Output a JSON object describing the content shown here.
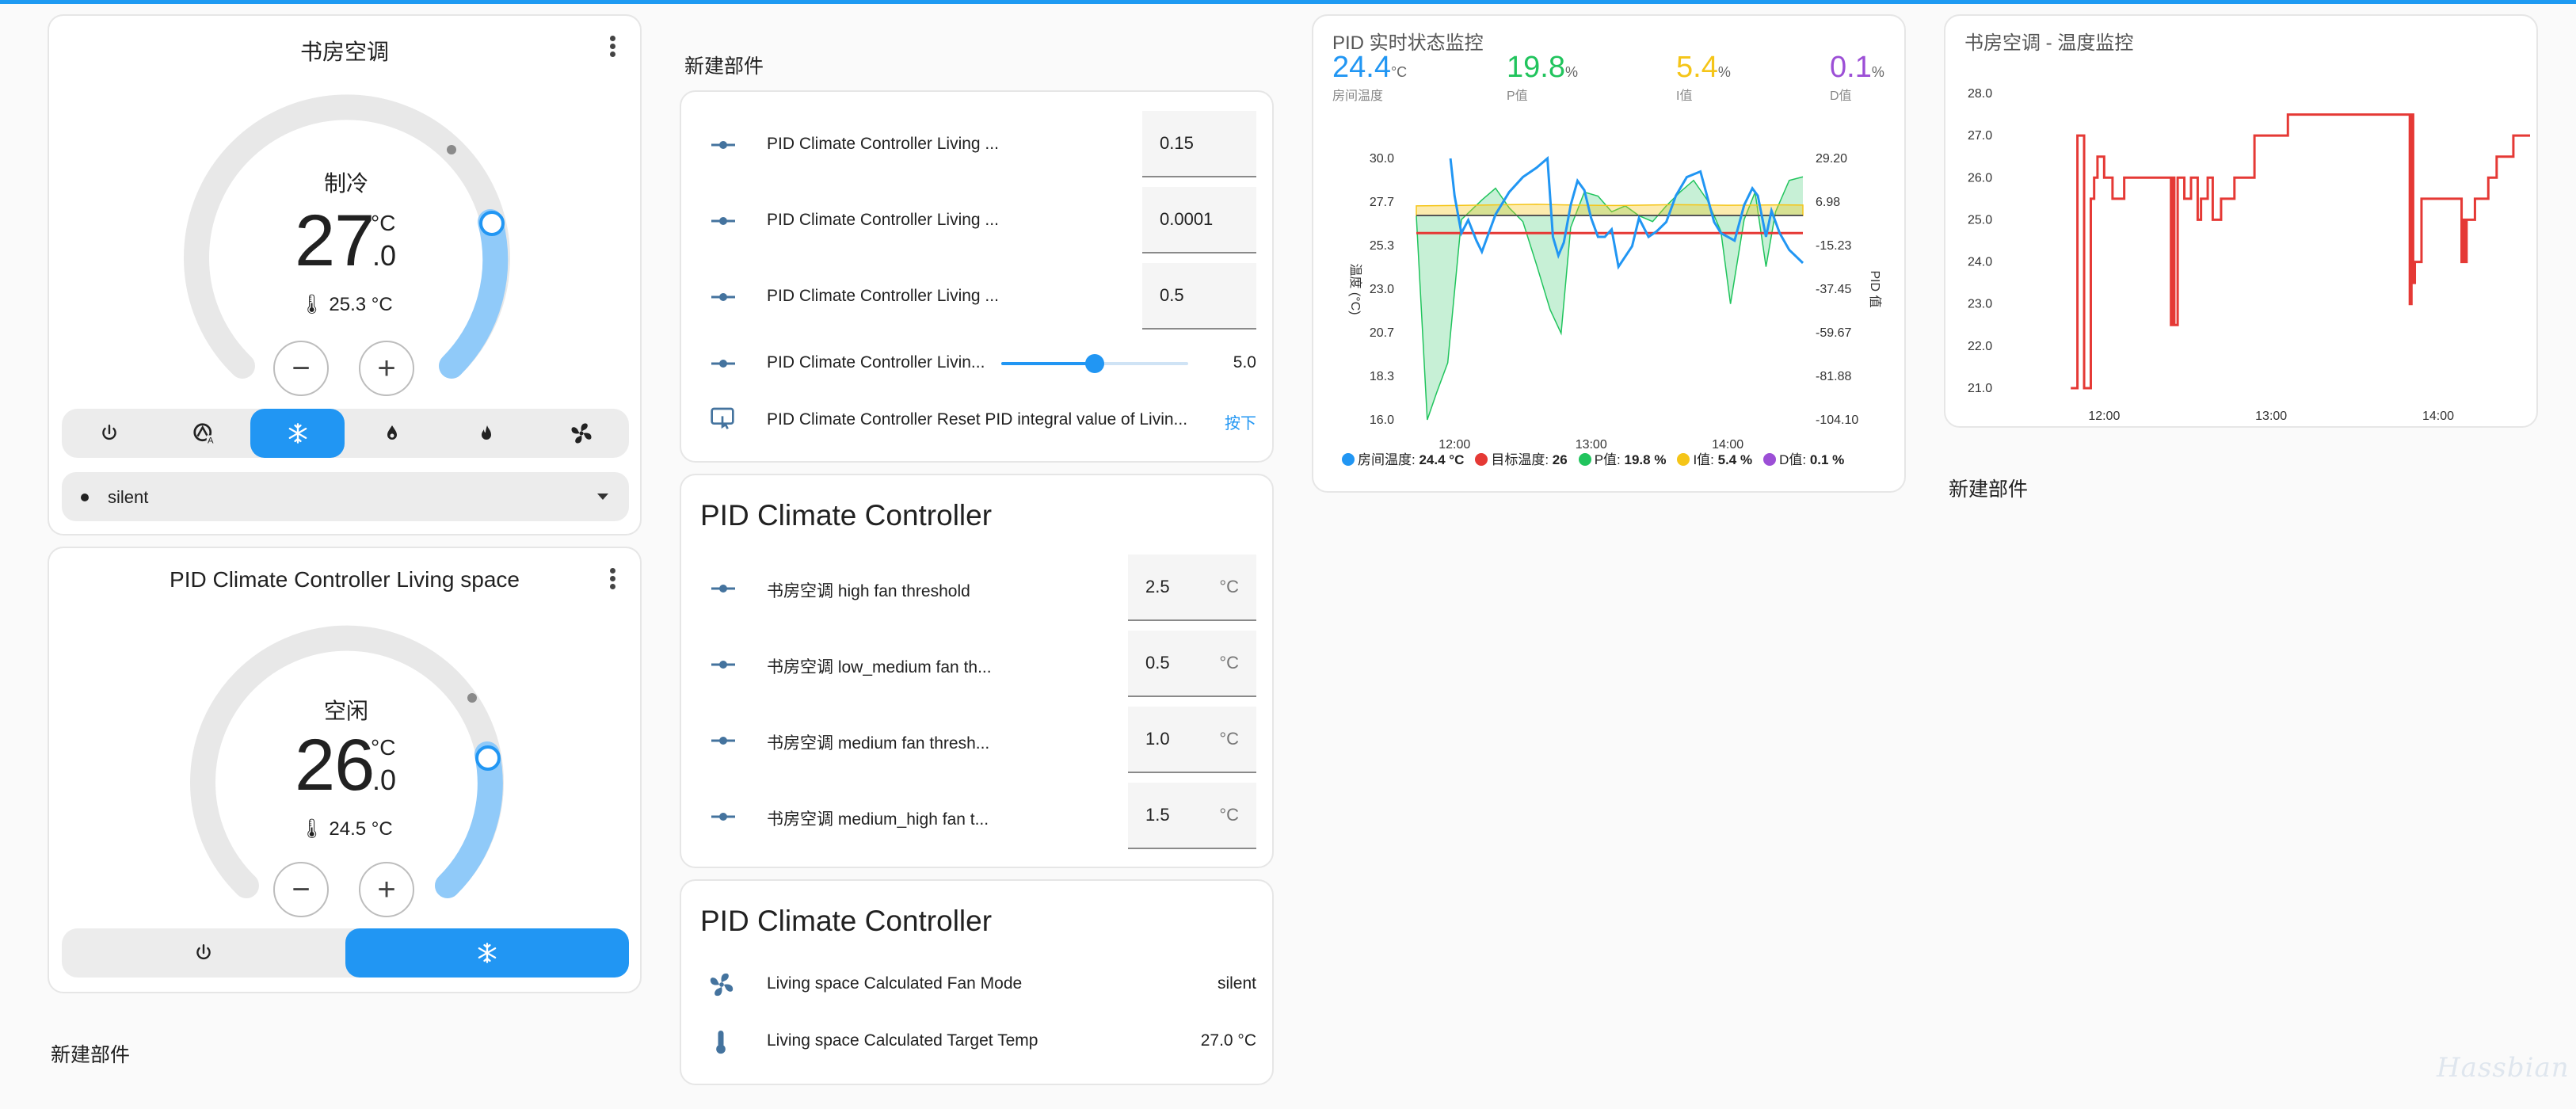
{
  "colors": {
    "accent": "#2196f3",
    "accent_light": "#90caf9",
    "track": "#e8e8e8",
    "red": "#e53935",
    "green": "#21c45d",
    "yellow": "#f5c518",
    "purple": "#9c4fd6"
  },
  "thermostat1": {
    "title": "书房空调",
    "mode": "制冷",
    "target_int": "27",
    "target_dec": ".0",
    "unit": "°C",
    "current": "25.3 °C",
    "modes": [
      {
        "icon": "power-icon",
        "active": false
      },
      {
        "icon": "auto-mode-icon",
        "active": false
      },
      {
        "icon": "snowflake-icon",
        "active": true
      },
      {
        "icon": "water-drop-icon",
        "active": false
      },
      {
        "icon": "flame-icon",
        "active": false
      },
      {
        "icon": "fan-icon",
        "active": false
      }
    ],
    "fan_select": "silent"
  },
  "thermostat2": {
    "title": "PID Climate Controller Living space",
    "mode": "空闲",
    "target_int": "26",
    "target_dec": ".0",
    "unit": "°C",
    "current": "24.5 °C",
    "modes": [
      {
        "icon": "power-icon",
        "active": false
      },
      {
        "icon": "snowflake-icon",
        "active": true
      }
    ]
  },
  "new_card_label": "新建部件",
  "entities1": {
    "title": "新建部件",
    "rows": [
      {
        "label": "PID Climate Controller Living ...",
        "value": "0.15"
      },
      {
        "label": "PID Climate Controller Living ...",
        "value": "0.0001"
      },
      {
        "label": "PID Climate Controller Living ...",
        "value": "0.5"
      }
    ],
    "slider": {
      "label": "PID Climate Controller Livin...",
      "value": "5.0",
      "fraction": 0.5
    },
    "button_row": {
      "label": "PID Climate Controller Reset PID integral value of Livin...",
      "action": "按下"
    }
  },
  "entities2": {
    "title": "PID Climate Controller",
    "rows": [
      {
        "label": "书房空调 high fan threshold",
        "value": "2.5",
        "unit": "°C"
      },
      {
        "label": "书房空调 low_medium fan th...",
        "value": "0.5",
        "unit": "°C"
      },
      {
        "label": "书房空调 medium fan thresh...",
        "value": "1.0",
        "unit": "°C"
      },
      {
        "label": "书房空调 medium_high fan t...",
        "value": "1.5",
        "unit": "°C"
      }
    ]
  },
  "entities3": {
    "title": "PID Climate Controller",
    "rows": [
      {
        "label": "Living space Calculated Fan Mode",
        "value": "silent",
        "icon": "fan-icon"
      },
      {
        "label": "Living space Calculated Target Temp",
        "value": "27.0 °C",
        "icon": "thermometer-icon"
      }
    ]
  },
  "pid_card": {
    "title": "PID 实时状态监控",
    "stats": [
      {
        "value": "24.4",
        "unit": "°C",
        "label": "房间温度",
        "color": "#2196f3"
      },
      {
        "value": "19.8",
        "unit": "%",
        "label": "P值",
        "color": "#21c45d"
      },
      {
        "value": "5.4",
        "unit": "%",
        "label": "I值",
        "color": "#f5c518"
      },
      {
        "value": "0.1",
        "unit": "%",
        "label": "D值",
        "color": "#9c4fd6"
      }
    ],
    "legend": [
      {
        "label": "房间温度:",
        "value": "24.4 °C",
        "color": "#2196f3"
      },
      {
        "label": "目标温度:",
        "value": "26",
        "color": "#e53935"
      },
      {
        "label": "P值:",
        "value": "19.8 %",
        "color": "#21c45d"
      },
      {
        "label": "I值:",
        "value": "5.4 %",
        "color": "#f5c518"
      },
      {
        "label": "D值:",
        "value": "0.1 %",
        "color": "#9c4fd6"
      }
    ]
  },
  "chart_data": [
    {
      "type": "line",
      "title": "PID 实时状态监控",
      "ylabel": "温度 (°C)",
      "y2label": "PID 值",
      "x_ticks": [
        "12:00",
        "13:00",
        "14:00"
      ],
      "y_ticks": [
        "30.0",
        "27.7",
        "25.3",
        "23.0",
        "20.7",
        "18.3",
        "16.0"
      ],
      "y2_ticks": [
        "29.20",
        "6.98",
        "-15.23",
        "-37.45",
        "-59.67",
        "-81.88",
        "-104.10"
      ],
      "ylim": [
        16.0,
        30.0
      ],
      "y2lim": [
        -104.1,
        29.2
      ],
      "xlim_hours": [
        11.72,
        14.55
      ],
      "series": [
        {
          "name": "房间温度",
          "axis": "left",
          "color": "#2196f3",
          "x": [
            11.97,
            12.0,
            12.05,
            12.1,
            12.16,
            12.2,
            12.3,
            12.4,
            12.5,
            12.6,
            12.68,
            12.72,
            12.76,
            12.8,
            12.85,
            12.9,
            12.95,
            13.0,
            13.05,
            13.1,
            13.15,
            13.2,
            13.3,
            13.35,
            13.42,
            13.48,
            13.55,
            13.62,
            13.7,
            13.8,
            13.9,
            13.95,
            14.05,
            14.12,
            14.18,
            14.22,
            14.28,
            14.32,
            14.38,
            14.45,
            14.55
          ],
          "y": [
            30.0,
            28.0,
            26.0,
            26.7,
            25.6,
            25.0,
            27.0,
            28.2,
            29.0,
            29.5,
            30.0,
            25.8,
            24.8,
            25.5,
            27.5,
            28.8,
            28.3,
            26.8,
            25.8,
            25.8,
            26.2,
            24.2,
            25.3,
            26.8,
            25.8,
            26.1,
            26.6,
            28.0,
            29.0,
            29.3,
            26.6,
            26.0,
            25.6,
            27.5,
            28.4,
            28.0,
            25.8,
            27.2,
            26.0,
            25.1,
            24.4
          ]
        },
        {
          "name": "目标温度",
          "axis": "left",
          "color": "#e53935",
          "x": [
            11.72,
            14.55
          ],
          "y": [
            26.0,
            26.0
          ]
        },
        {
          "name": "P值",
          "axis": "right",
          "color": "#21c45d",
          "x": [
            11.72,
            11.8,
            11.87,
            11.95,
            12.05,
            12.2,
            12.3,
            12.4,
            12.5,
            12.6,
            12.7,
            12.78,
            12.85,
            12.95,
            13.05,
            13.15,
            13.25,
            13.35,
            13.45,
            13.55,
            13.65,
            13.75,
            13.85,
            13.95,
            14.02,
            14.12,
            14.2,
            14.28,
            14.35,
            14.45,
            14.55
          ],
          "y": [
            0,
            -104.1,
            -90,
            -75,
            -2,
            8,
            14,
            4,
            -3,
            -25,
            -48,
            -60,
            -6,
            12,
            10,
            2,
            5,
            0,
            -3,
            5,
            12,
            18,
            8,
            -8,
            -45,
            -2,
            12,
            -26,
            2,
            18,
            19.8
          ]
        },
        {
          "name": "I值",
          "axis": "right",
          "color": "#f5c518",
          "x": [
            11.72,
            12.0,
            12.2,
            12.4,
            12.6,
            12.8,
            13.0,
            13.2,
            13.4,
            13.6,
            13.8,
            14.0,
            14.2,
            14.4,
            14.55
          ],
          "y": [
            5.0,
            5.2,
            5.4,
            5.6,
            5.8,
            5.5,
            5.3,
            5.2,
            5.4,
            5.6,
            5.5,
            5.3,
            5.4,
            5.5,
            5.4
          ]
        },
        {
          "name": "D值",
          "axis": "right",
          "color": "#9c4fd6",
          "x": [
            11.72,
            14.55
          ],
          "y": [
            0.1,
            0.1
          ]
        }
      ]
    },
    {
      "type": "line",
      "title": "书房空调 - 温度监控",
      "x_ticks": [
        "12:00",
        "13:00",
        "14:00"
      ],
      "y_ticks": [
        "28.0",
        "27.0",
        "26.0",
        "25.0",
        "24.0",
        "23.0",
        "22.0",
        "21.0"
      ],
      "ylim": [
        21.0,
        28.0
      ],
      "xlim_hours": [
        11.6,
        14.55
      ],
      "series": [
        {
          "name": "书房空调",
          "color": "#e53935",
          "step": true,
          "x": [
            11.8,
            11.84,
            11.88,
            11.92,
            11.94,
            11.96,
            12.0,
            12.05,
            12.12,
            12.2,
            12.38,
            12.4,
            12.41,
            12.42,
            12.44,
            12.46,
            12.48,
            12.52,
            12.54,
            12.56,
            12.58,
            12.62,
            12.65,
            12.7,
            12.78,
            12.82,
            12.9,
            13.1,
            13.25,
            13.5,
            13.83,
            13.84,
            13.85,
            13.86,
            13.9,
            13.92,
            14.02,
            14.12,
            14.14,
            14.15,
            14.16,
            14.17,
            14.22,
            14.3,
            14.35,
            14.38,
            14.45,
            14.55
          ],
          "y": [
            21.0,
            27.0,
            21.0,
            25.5,
            26.0,
            26.5,
            26.0,
            25.5,
            26.0,
            26.0,
            26.0,
            22.5,
            26.0,
            22.5,
            26.0,
            26.0,
            25.5,
            26.0,
            26.0,
            25.0,
            25.5,
            26.0,
            25.0,
            25.5,
            26.0,
            26.0,
            27.0,
            27.5,
            27.5,
            27.5,
            23.0,
            27.5,
            23.5,
            24.0,
            25.5,
            25.5,
            25.5,
            25.5,
            24.0,
            25.0,
            24.0,
            25.0,
            25.5,
            26.0,
            26.5,
            26.5,
            27.0,
            27.0
          ]
        }
      ]
    }
  ]
}
